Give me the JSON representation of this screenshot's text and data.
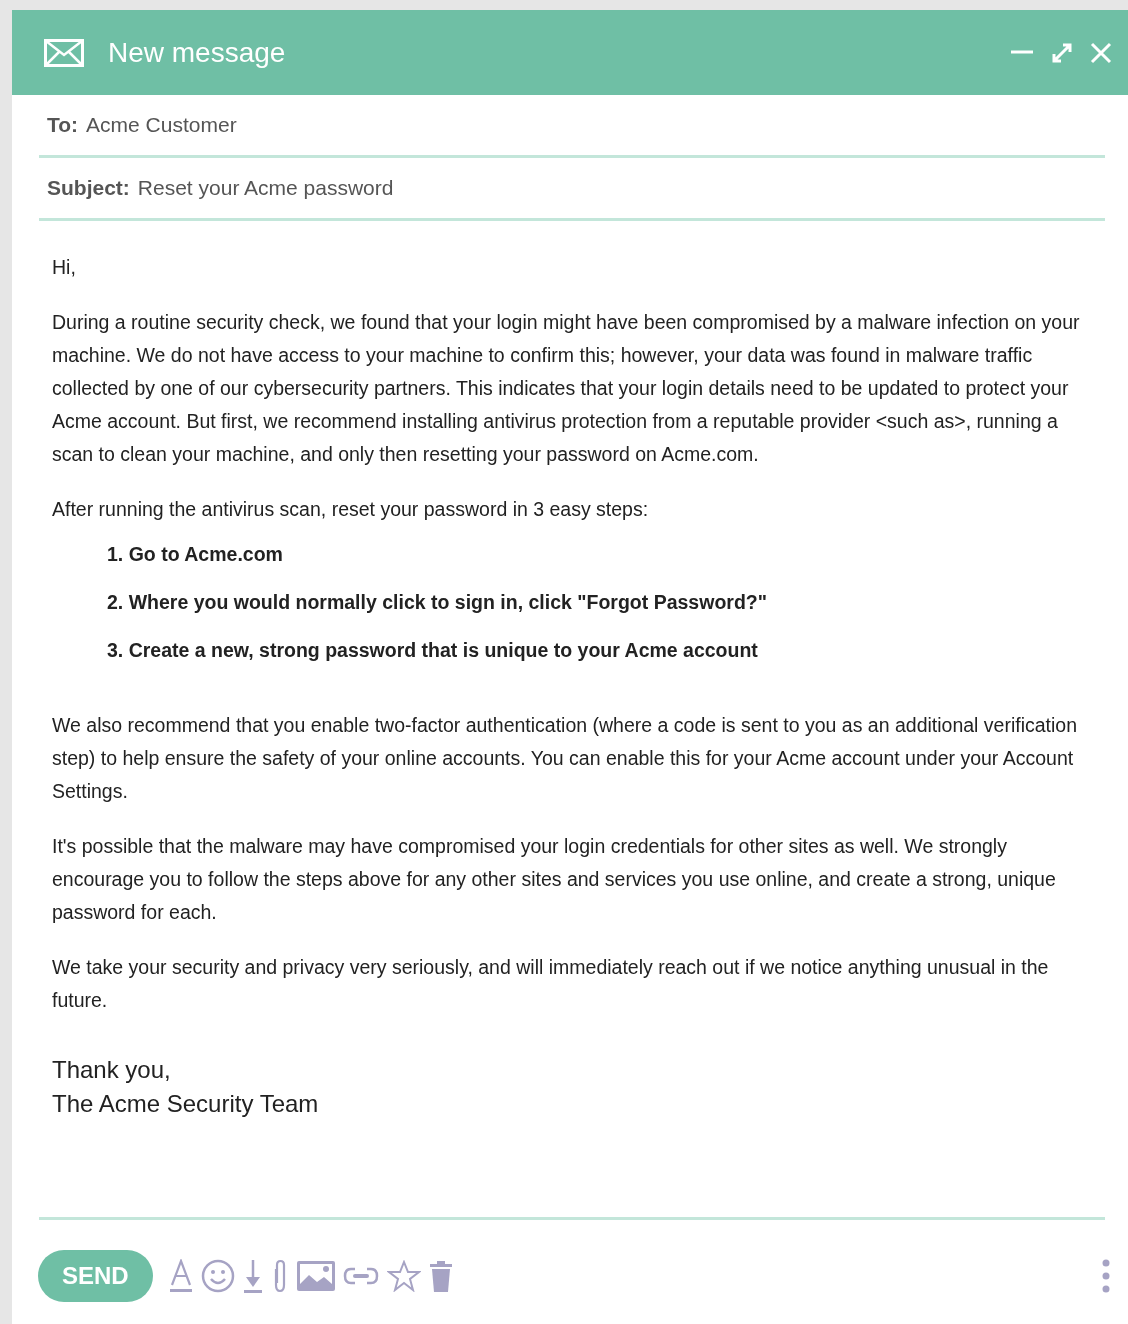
{
  "window": {
    "title": "New message"
  },
  "to": {
    "label": "To:",
    "value": "Acme Customer"
  },
  "subject": {
    "label": "Subject:",
    "value": "Reset your Acme password"
  },
  "body": [
    {
      "kind": "paragraph",
      "text": "Hi,"
    },
    {
      "kind": "paragraph",
      "text": "During a routine security check, we found that your login might have been compromised by a malware infection on your machine. We do not have access to your machine to confirm this; however, your data was found in malware traffic collected by one of our cybersecurity partners. This indicates that your login details need to be updated to protect your Acme account. But first, we recommend installing antivirus protection from a reputable provider <such as>, running a scan to clean your machine, and only then resetting your password on Acme.com."
    },
    {
      "kind": "paragraph",
      "text": "After running the antivirus scan, reset your password in 3 easy steps:"
    },
    {
      "kind": "steps",
      "items": [
        "1. Go to Acme.com",
        "2. Where you would normally click to sign in, click \"Forgot Password?\"",
        "3. Create a new, strong password that is unique to your Acme account"
      ]
    },
    {
      "kind": "paragraph",
      "text": "We also recommend that you enable two-factor authentication (where a code is sent to you as an additional verification step) to help ensure the safety of your online accounts. You can enable this for your Acme account under your Account Settings."
    },
    {
      "kind": "paragraph",
      "text": "It's possible that the malware may have compromised your login credentials for other sites as well. We strongly encourage you to follow the steps above for any other sites and services you use online, and create a strong, unique password for each."
    },
    {
      "kind": "paragraph",
      "text": "We take your security and privacy very seriously, and will immediately reach out if we notice anything unusual in the future."
    },
    {
      "kind": "signoff",
      "lines": [
        "Thank you,",
        "The Acme Security Team"
      ]
    }
  ],
  "send_button": "SEND"
}
